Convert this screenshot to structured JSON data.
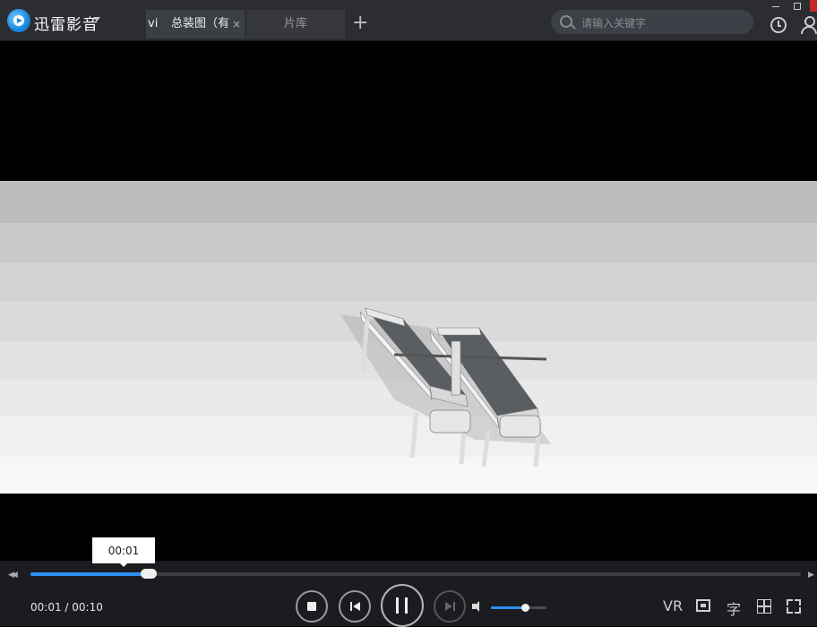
{
  "app": {
    "name": "迅雷影音"
  },
  "tabs": [
    {
      "prefix": "vi",
      "title": "总装图（有",
      "close": "×",
      "active": true
    },
    {
      "title": "片库",
      "active": false
    }
  ],
  "tab_add_label": "+",
  "search": {
    "placeholder": "请输入关键字",
    "value": ""
  },
  "player": {
    "current_time": "00:01",
    "duration": "00:10",
    "time_display": "00:01 / 00:10",
    "tooltip_time": "00:01",
    "progress_fraction": 0.154,
    "volume_fraction": 0.62,
    "vr_label": "VR",
    "subtitle_label": "字"
  },
  "colors": {
    "accent": "#2e8ff0",
    "titlebar": "#2b2d31",
    "control_bar": "#1b1c1f",
    "close_button": "#c62828"
  },
  "icons": {
    "logo": "xunlei-logo-icon",
    "search": "search-icon",
    "history": "history-icon",
    "user": "user-icon",
    "stop": "stop-icon",
    "prev": "previous-icon",
    "pause": "pause-icon",
    "next": "next-icon",
    "volume": "volume-icon",
    "pip": "picture-in-picture-icon",
    "grid": "grid-icon",
    "fullscreen": "fullscreen-icon"
  }
}
